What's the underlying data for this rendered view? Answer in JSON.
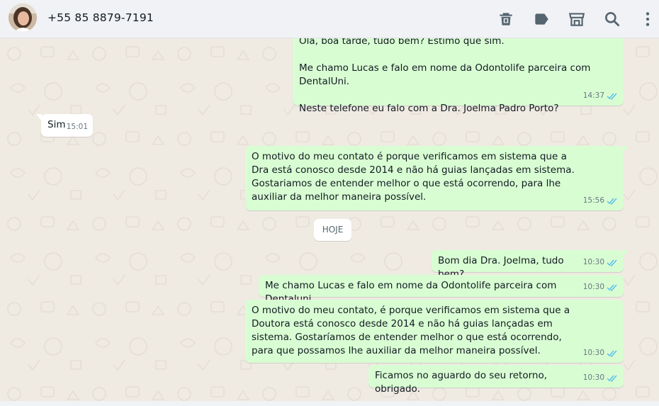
{
  "header": {
    "contact_name": "+55 85 8879-7191",
    "icons": [
      "delete-icon",
      "label-icon",
      "store-icon",
      "search-icon",
      "menu-icon"
    ]
  },
  "messages": [
    {
      "direction": "out",
      "paragraphs": [
        "Olá, boa tarde, tudo bem? Estimo que sim.",
        "Me chamo Lucas e falo em nome da Odontolife parceira com DentalUni.",
        "Neste telefone eu falo com a Dra. Joelma Padro Porto?"
      ],
      "time": "14:37",
      "status": "read"
    },
    {
      "direction": "in",
      "paragraphs": [
        "Sim"
      ],
      "time": "15:01"
    },
    {
      "direction": "out",
      "paragraphs": [
        "O motivo do meu contato é porque verificamos em sistema que a Dra está conosco desde 2014 e não há guias lançadas em sistema. Gostariamos de entender melhor o que está ocorrendo, para lhe auxiliar da melhor maneira possível."
      ],
      "time": "15:56",
      "status": "read"
    },
    {
      "direction": "out",
      "paragraphs": [
        "Bom dia Dra. Joelma, tudo bem?"
      ],
      "time": "10:30",
      "status": "read"
    },
    {
      "direction": "out",
      "paragraphs": [
        "Me chamo Lucas e falo em nome da Odontolife parceira com Dentaluni"
      ],
      "time": "10:30",
      "status": "read"
    },
    {
      "direction": "out",
      "paragraphs": [
        "O motivo do meu contato, é porque verificamos em sistema que a Doutora está conosco desde 2014 e não há guias lançadas em sistema. Gostaríamos de entender melhor o que está ocorrendo, para que possamos lhe auxiliar da melhor maneira possível."
      ],
      "time": "10:30",
      "status": "read"
    },
    {
      "direction": "out",
      "paragraphs": [
        "Ficamos no aguardo do seu retorno, obrigado."
      ],
      "time": "10:30",
      "status": "read"
    }
  ],
  "day_separator": "HOJE",
  "colors": {
    "outgoing_bubble": "#d9fdd3",
    "incoming_bubble": "#ffffff",
    "chat_background": "#efeae2",
    "header_background": "#f0f2f5",
    "read_ticks": "#53bdeb",
    "meta_text": "#667781"
  }
}
